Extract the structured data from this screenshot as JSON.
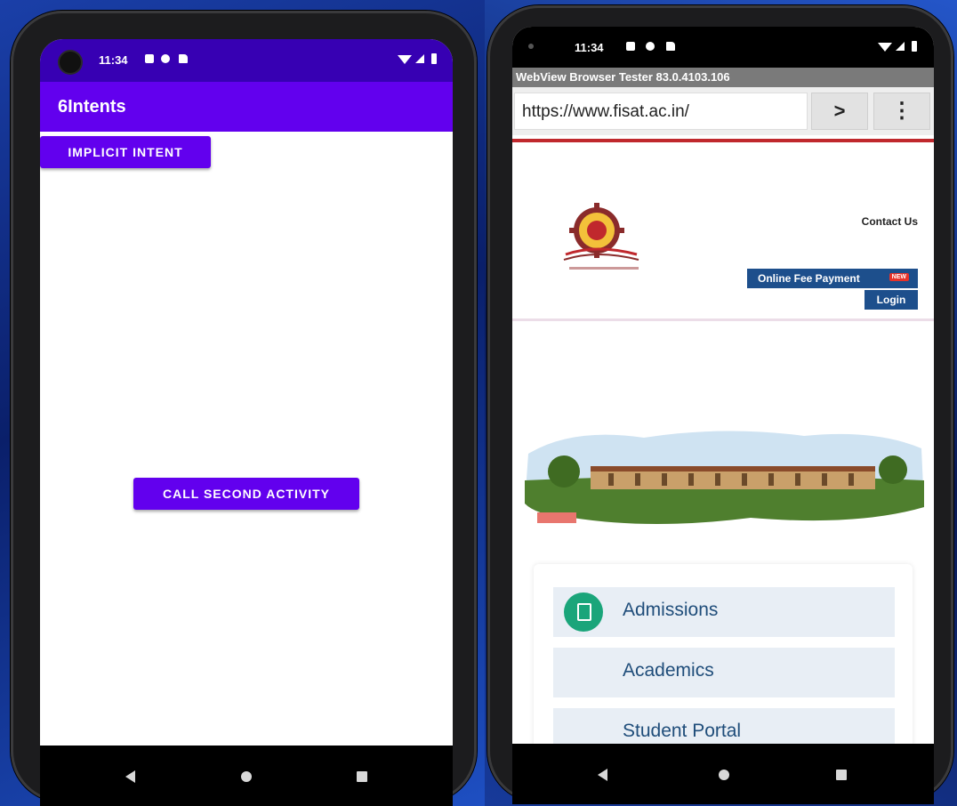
{
  "left_phone": {
    "status_time": "11:34",
    "app_title": "6Intents",
    "implicit_button": "IMPLICIT INTENT",
    "second_activity_button": "CALL SECOND ACTIVITY",
    "toolbar_color": "#6200ee"
  },
  "right_phone": {
    "status_time": "11:34",
    "browser_title": "WebView Browser Tester 83.0.4103.106",
    "url": "https://www.fisat.ac.in/",
    "go_button": ">",
    "menu_button": "⋮",
    "contact_link": "Contact Us",
    "fee_button": "Online Fee Payment",
    "fee_badge": "NEW",
    "login_button": "Login",
    "nav_items": [
      {
        "label": "Admissions",
        "icon": "document-check-icon"
      },
      {
        "label": "Academics"
      },
      {
        "label": "Student Portal"
      }
    ]
  }
}
